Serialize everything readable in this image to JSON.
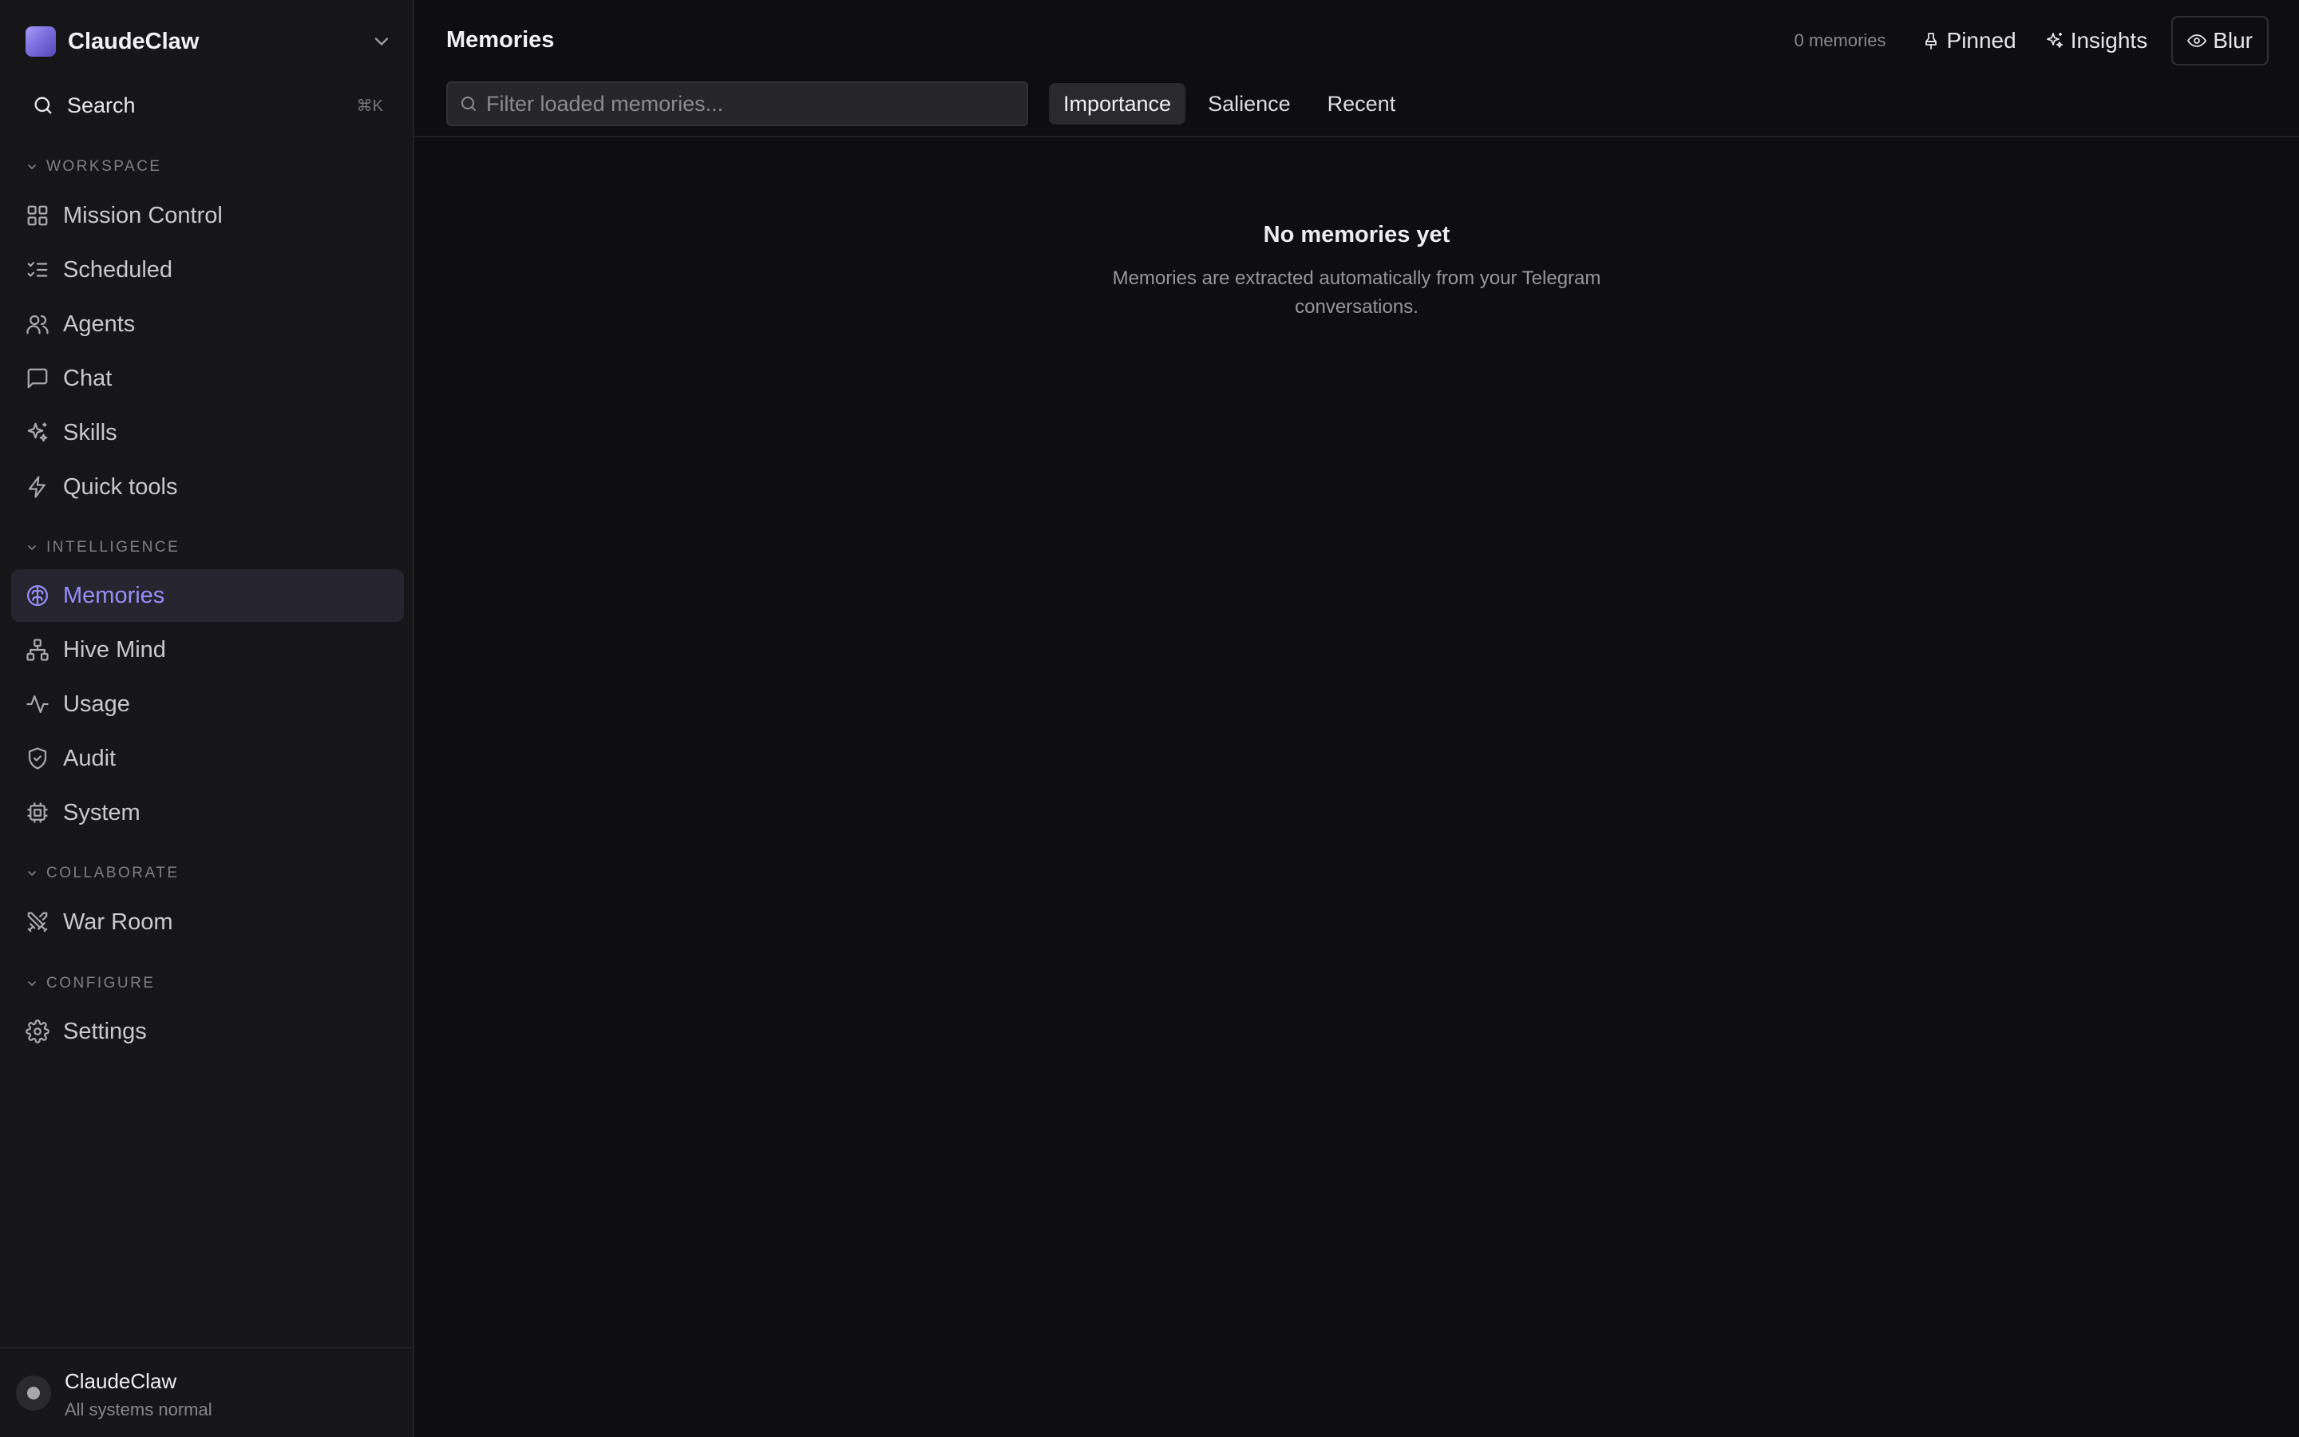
{
  "app": {
    "name": "ClaudeClaw"
  },
  "search": {
    "label": "Search",
    "shortcut": "⌘K"
  },
  "sidebar": {
    "sections": [
      {
        "title": "WORKSPACE"
      },
      {
        "title": "INTELLIGENCE"
      },
      {
        "title": "COLLABORATE"
      },
      {
        "title": "CONFIGURE"
      }
    ],
    "items": [
      {
        "label": "Mission Control",
        "icon": "grid-icon"
      },
      {
        "label": "Scheduled",
        "icon": "list-checks-icon"
      },
      {
        "label": "Agents",
        "icon": "users-icon"
      },
      {
        "label": "Chat",
        "icon": "message-square-icon"
      },
      {
        "label": "Skills",
        "icon": "sparkles-icon"
      },
      {
        "label": "Quick tools",
        "icon": "zap-icon"
      },
      {
        "label": "Memories",
        "icon": "brain-icon",
        "active": true
      },
      {
        "label": "Hive Mind",
        "icon": "network-icon"
      },
      {
        "label": "Usage",
        "icon": "activity-icon"
      },
      {
        "label": "Audit",
        "icon": "shield-check-icon"
      },
      {
        "label": "System",
        "icon": "cpu-icon"
      },
      {
        "label": "War Room",
        "icon": "swords-icon"
      },
      {
        "label": "Settings",
        "icon": "gear-icon"
      }
    ],
    "footer": {
      "name": "ClaudeClaw",
      "status": "All systems normal"
    }
  },
  "main": {
    "title": "Memories",
    "count_label": "0 memories",
    "actions": {
      "pinned": "Pinned",
      "insights": "Insights",
      "blur": "Blur"
    },
    "filter": {
      "placeholder": "Filter loaded memories...",
      "value": ""
    },
    "sort_tabs": [
      {
        "label": "Importance",
        "active": true
      },
      {
        "label": "Salience"
      },
      {
        "label": "Recent"
      }
    ],
    "empty": {
      "title": "No memories yet",
      "description": "Memories are extracted automatically from your Telegram conversations."
    }
  },
  "colors": {
    "background": "#0e0e10",
    "sidebar": "#161618",
    "accent": "#9a8ef5",
    "active_bg": "#25242f"
  }
}
